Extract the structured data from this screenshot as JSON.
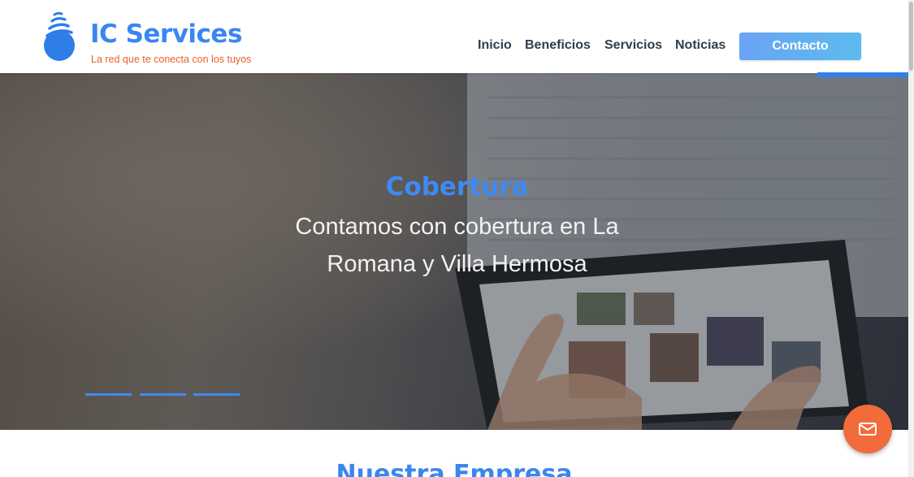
{
  "header": {
    "brand_title": "IC Services",
    "brand_tagline": "La red que te conecta con los tuyos",
    "logo_icon": "wifi-drop-logo-icon",
    "nav": [
      {
        "label": "Inicio"
      },
      {
        "label": "Beneficios"
      },
      {
        "label": "Servicios"
      },
      {
        "label": "Noticias"
      }
    ],
    "contact_label": "Contacto"
  },
  "hero": {
    "title": "Cobertura",
    "text": "Contamos con cobertura en La Romana y Villa Hermosa",
    "slides_count": 3
  },
  "section": {
    "title": "Nuestra Empresa"
  },
  "fab": {
    "icon": "mail-icon"
  },
  "colors": {
    "brand_blue": "#3a86f0",
    "tagline_orange": "#e8602c",
    "nav_text": "#2d3e50",
    "fab_orange": "#f26b3a"
  }
}
